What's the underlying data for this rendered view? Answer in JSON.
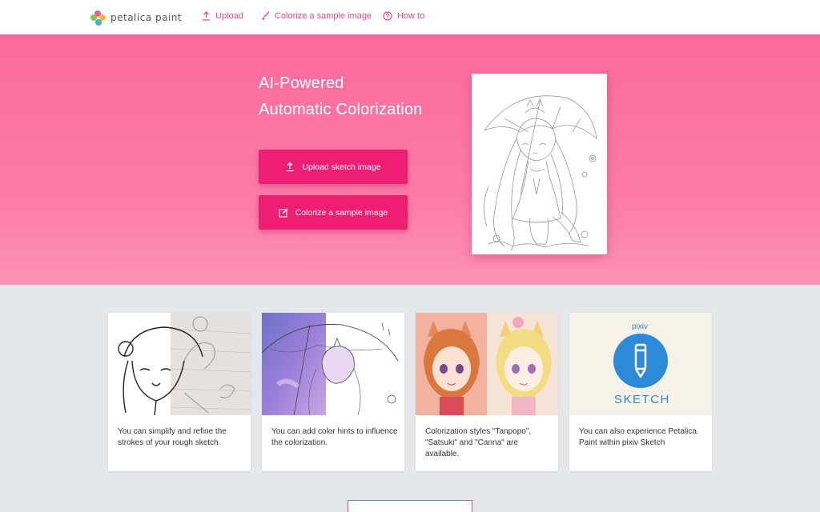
{
  "header": {
    "logo_text": "petalica paint",
    "nav": [
      {
        "label": "Upload",
        "icon": "upload-icon"
      },
      {
        "label": "Colorize a sample image",
        "icon": "brush-icon"
      },
      {
        "label": "How to",
        "icon": "question-icon"
      }
    ]
  },
  "hero": {
    "title_line1": "AI-Powered",
    "title_line2": "Automatic Colorization",
    "upload_button": "Upload sketch image",
    "sample_button": "Colorize a sample image"
  },
  "cards": [
    {
      "text": "You can simplify and refine the strokes of your rough sketch."
    },
    {
      "text": "You can add color hints to influence the colorization."
    },
    {
      "text": "Colorization styles \"Tanpopo\", \"Satsuki\" and \"Canna\" are available."
    },
    {
      "text": "You can also experience Petalica Paint within pixiv Sketch"
    }
  ],
  "pixiv": {
    "brand": "pixiv",
    "product": "SKETCH"
  },
  "colors": {
    "accent": "#ee1f73",
    "nav_text": "#e84a7f",
    "hero_top": "#fb6a9c",
    "pixiv_blue": "#2b8bd8"
  }
}
